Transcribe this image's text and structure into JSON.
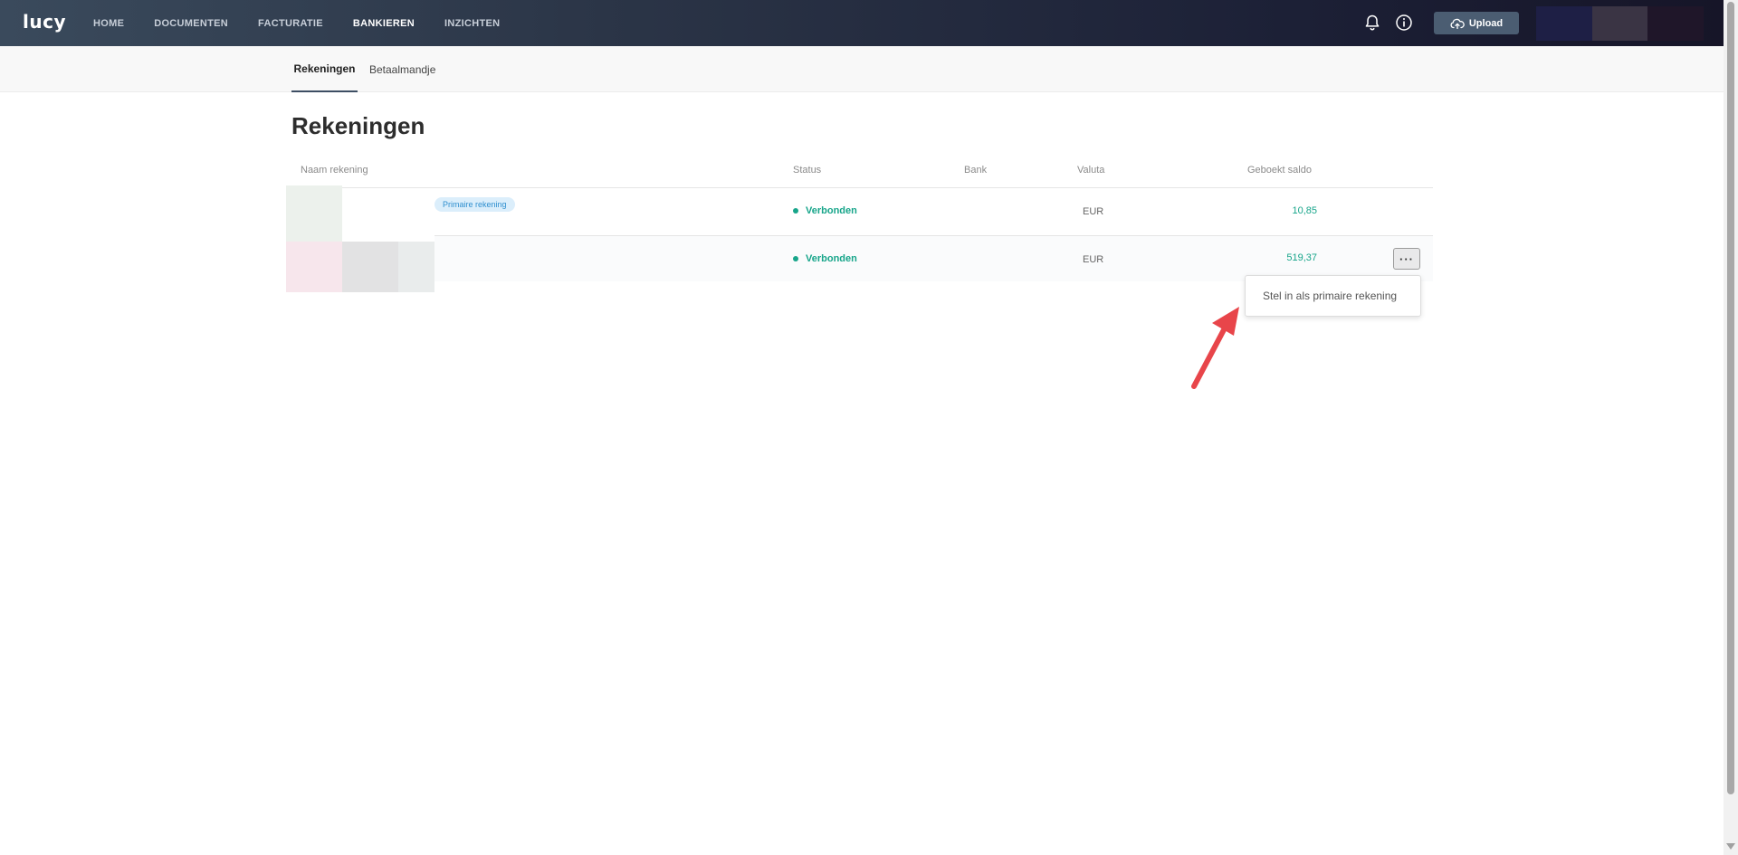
{
  "app": {
    "logo": "lucy"
  },
  "nav": {
    "items": [
      {
        "label": "HOME"
      },
      {
        "label": "DOCUMENTEN"
      },
      {
        "label": "FACTURATIE"
      },
      {
        "label": "BANKIEREN"
      },
      {
        "label": "INZICHTEN"
      }
    ],
    "active": "BANKIEREN"
  },
  "header": {
    "upload_label": "Upload"
  },
  "subnav": {
    "tabs": [
      {
        "label": "Rekeningen"
      },
      {
        "label": "Betaalmandje"
      }
    ],
    "active": "Rekeningen"
  },
  "page": {
    "title": "Rekeningen"
  },
  "table": {
    "columns": {
      "name": "Naam rekening",
      "status": "Status",
      "bank": "Bank",
      "currency": "Valuta",
      "balance": "Geboekt saldo"
    },
    "rows": [
      {
        "badge": "Primaire rekening",
        "status": "Verbonden",
        "currency": "EUR",
        "balance": "10,85"
      },
      {
        "badge": "",
        "status": "Verbonden",
        "currency": "EUR",
        "balance": "519,37"
      }
    ]
  },
  "menu": {
    "more_label": "···",
    "items": [
      {
        "label": "Stel in als primaire rekening"
      }
    ]
  },
  "colors": {
    "accent": "#17a58a",
    "header": "#2b3547",
    "annotation": "#e8454a"
  }
}
